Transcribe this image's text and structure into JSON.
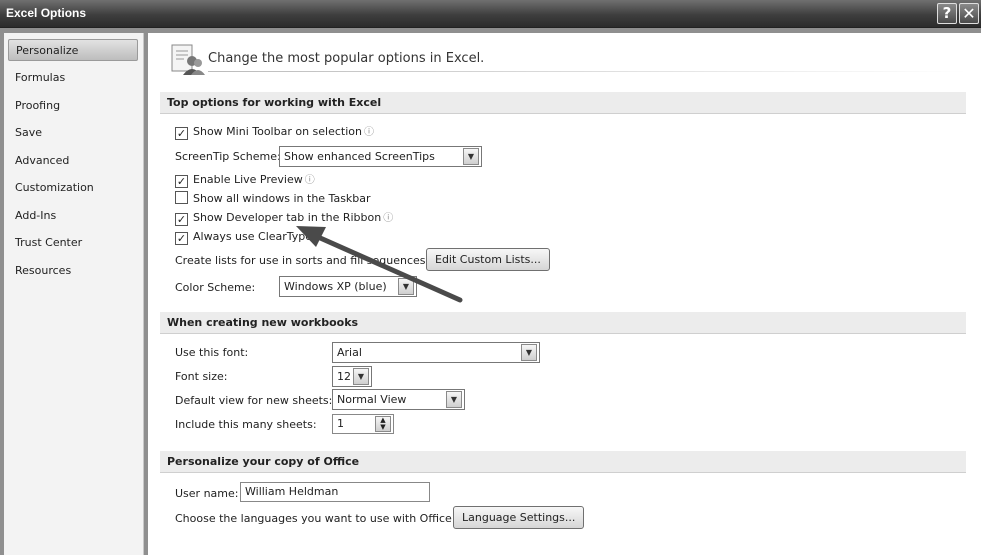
{
  "window": {
    "title": "Excel Options",
    "help_glyph": "?",
    "close_glyph": "✕"
  },
  "nav": {
    "items": [
      "Personalize",
      "Formulas",
      "Proofing",
      "Save",
      "Advanced",
      "Customization",
      "Add-Ins",
      "Trust Center",
      "Resources"
    ],
    "selected": "Personalize"
  },
  "header": {
    "text": "Change the most popular options in Excel."
  },
  "sections": {
    "top": {
      "title": "Top options for working with Excel"
    },
    "new_workbooks": {
      "title": "When creating new workbooks"
    },
    "personalize": {
      "title": "Personalize your copy of Office"
    }
  },
  "top_options": {
    "mini_toolbar": {
      "label": "Show Mini Toolbar on selection",
      "checked": true
    },
    "screentip": {
      "label": "ScreenTip Scheme:",
      "value": "Show enhanced ScreenTips"
    },
    "live_preview": {
      "label": "Enable Live Preview",
      "checked": true
    },
    "all_windows": {
      "label": "Show all windows in the Taskbar",
      "checked": false
    },
    "developer_tab": {
      "label": "Show Developer tab in the Ribbon",
      "checked": true
    },
    "cleartype": {
      "label": "Always use ClearType",
      "checked": true
    },
    "custom_lists": {
      "label": "Create lists for use in sorts and fill sequences:",
      "button": "Edit Custom Lists..."
    },
    "color_scheme": {
      "label": "Color Scheme:",
      "value": "Windows XP (blue)"
    }
  },
  "new_workbooks": {
    "font": {
      "label": "Use this font:",
      "value": "Arial"
    },
    "font_size": {
      "label": "Font size:",
      "value": "12"
    },
    "default_view": {
      "label": "Default view for new sheets:",
      "value": "Normal View"
    },
    "sheets": {
      "label": "Include this many sheets:",
      "value": "1"
    }
  },
  "personalize": {
    "user_name": {
      "label": "User name:",
      "value": "William Heldman"
    },
    "languages": {
      "label": "Choose the languages you want to use with Office",
      "button": "Language Settings..."
    }
  },
  "icons": {
    "info": "info-icon",
    "check": "✓",
    "dropdown": "▼",
    "spin_up": "▲",
    "spin_down": "▼"
  },
  "colors": {
    "titlebar": "#3e3e3e",
    "section_bg": "#ececec",
    "nav_bg": "#f3f3f3",
    "annotation_arrow": "#4a4a4a"
  }
}
